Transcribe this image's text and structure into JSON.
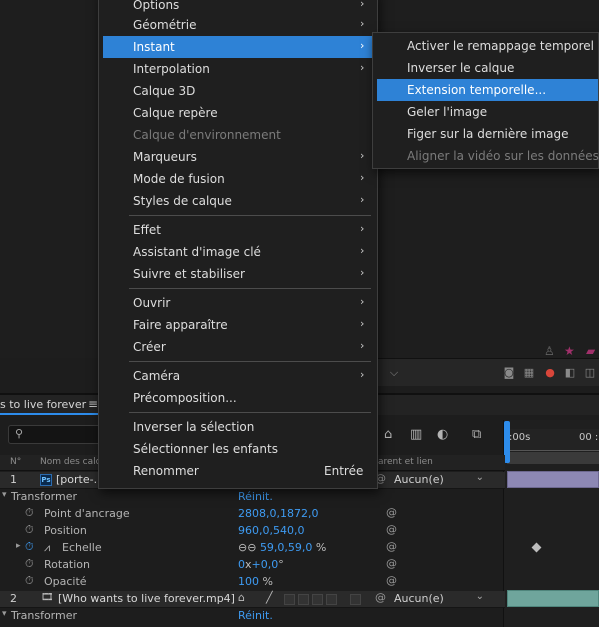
{
  "menu": {
    "items": [
      {
        "label": "Options",
        "arrow": "›"
      },
      {
        "label": "Géométrie",
        "arrow": "›"
      },
      {
        "label": "Instant",
        "arrow": "›"
      },
      {
        "label": "Interpolation",
        "arrow": "›"
      },
      {
        "label": "Calque 3D"
      },
      {
        "label": "Calque repère"
      },
      {
        "label": "Calque d'environnement"
      },
      {
        "label": "Marqueurs",
        "arrow": "›"
      },
      {
        "label": "Mode de fusion",
        "arrow": "›"
      },
      {
        "label": "Styles de calque",
        "arrow": "›"
      },
      {
        "label": "Effet",
        "arrow": "›"
      },
      {
        "label": "Assistant d'image clé",
        "arrow": "›"
      },
      {
        "label": "Suivre et stabiliser",
        "arrow": "›"
      },
      {
        "label": "Ouvrir",
        "arrow": "›"
      },
      {
        "label": "Faire apparaître",
        "arrow": "›"
      },
      {
        "label": "Créer",
        "arrow": "›"
      },
      {
        "label": "Caméra",
        "arrow": "›"
      },
      {
        "label": "Précomposition..."
      },
      {
        "label": "Inverser la sélection"
      },
      {
        "label": "Sélectionner les enfants"
      },
      {
        "label": "Renommer",
        "shortcut": "Entrée"
      }
    ]
  },
  "submenu": {
    "items": [
      {
        "label": "Activer le remappage temporel"
      },
      {
        "label": "Inverser le calque"
      },
      {
        "label": "Extension temporelle..."
      },
      {
        "label": "Geler l'image"
      },
      {
        "label": "Figer sur la dernière image"
      },
      {
        "label": "Aligner la vidéo sur les données"
      }
    ]
  },
  "comp_panel": {
    "tab_title": "s to live forever",
    "tab_menu": "≡",
    "search_icon": "⚲",
    "columns": {
      "num": "N°",
      "name": "Nom des calq",
      "parent": "arent et lien"
    },
    "ruler": {
      "start": ":00s",
      "next": "00 :"
    }
  },
  "layers": [
    {
      "num": "1",
      "name": "[porte-...",
      "badge": "Ps",
      "parent": "Aucun(e)"
    },
    {
      "num": "2",
      "name": "[Who wants to live forever.mp4]",
      "parent": "Aucun(e)"
    }
  ],
  "transform": {
    "group_label": "Transformer",
    "reset": "Réinit.",
    "props": [
      {
        "label": "Point d'ancrage",
        "value": "2808,0,1872,0"
      },
      {
        "label": "Position",
        "value": "960,0,540,0"
      },
      {
        "label": "Echelle",
        "link": "⊖⊖",
        "value": "59,0,59,0",
        "unit": "%"
      },
      {
        "label": "Rotation",
        "value": "0",
        "value2": "+0,0",
        "unit": "x",
        "unit2": "°"
      },
      {
        "label": "Opacité",
        "value": "100",
        "unit": "%"
      }
    ],
    "group2_label": "Transformer",
    "reset2": "Réinit."
  },
  "colors": {
    "accent": "#2e82d6",
    "value_blue": "#3e9bf2",
    "lavender_bar": "#8d88b4",
    "teal_bar": "#6fa59c"
  }
}
